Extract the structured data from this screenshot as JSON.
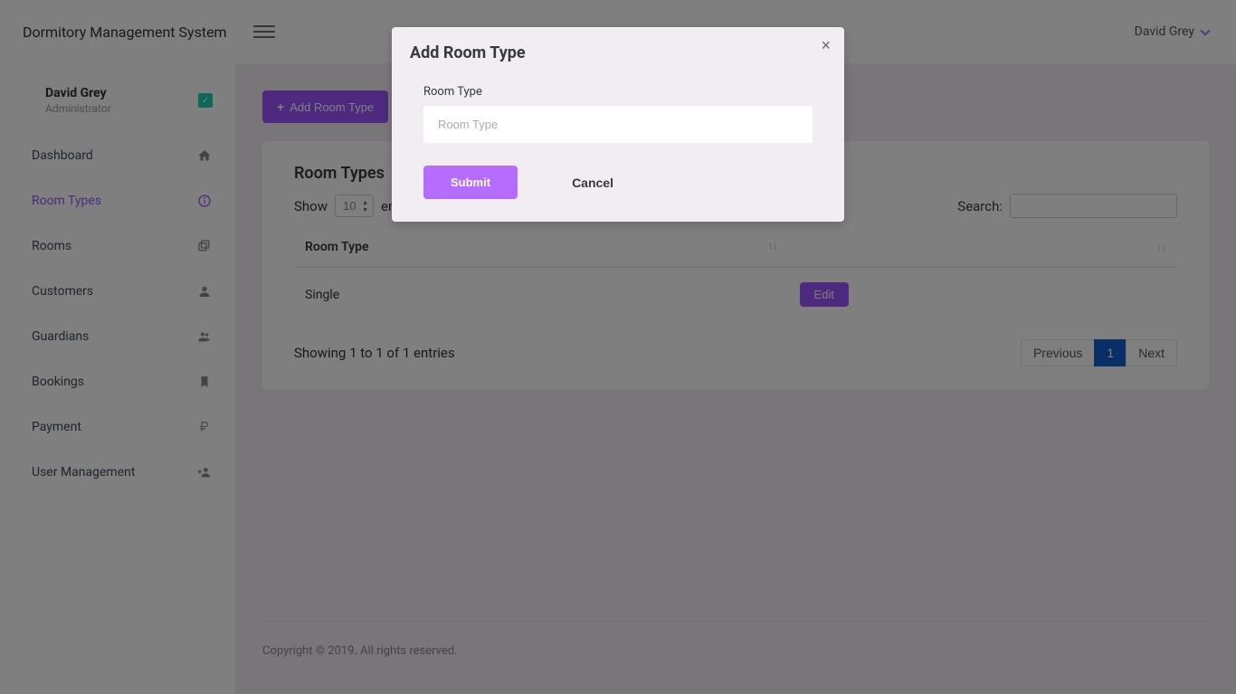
{
  "brand": "Dormitory Management System",
  "topbar": {
    "user": "David Grey"
  },
  "sidebar": {
    "profile": {
      "name": "David Grey",
      "role": "Administrator"
    },
    "items": [
      {
        "label": "Dashboard",
        "icon": "home"
      },
      {
        "label": "Room Types",
        "icon": "info"
      },
      {
        "label": "Rooms",
        "icon": "layers"
      },
      {
        "label": "Customers",
        "icon": "person"
      },
      {
        "label": "Guardians",
        "icon": "group"
      },
      {
        "label": "Bookings",
        "icon": "bookmark"
      },
      {
        "label": "Payment",
        "icon": "ruble"
      },
      {
        "label": "User Management",
        "icon": "person-add"
      }
    ]
  },
  "page": {
    "addButton": "Add Room Type",
    "cardTitle": "Room Types",
    "showLabel": "Show",
    "entriesLabel": "entries",
    "entriesValue": "10",
    "searchLabel": "Search:",
    "columns": {
      "c0": "Room Type",
      "c1": ""
    },
    "rows": [
      {
        "c0": "Single",
        "action": "Edit"
      }
    ],
    "info": "Showing 1 to 1 of 1 entries",
    "pager": {
      "prev": "Previous",
      "page": "1",
      "next": "Next"
    }
  },
  "footer": "Copyright © 2019. All rights reserved.",
  "modal": {
    "title": "Add Room Type",
    "fieldLabel": "Room Type",
    "placeholder": "Room Type",
    "submit": "Submit",
    "cancel": "Cancel"
  }
}
